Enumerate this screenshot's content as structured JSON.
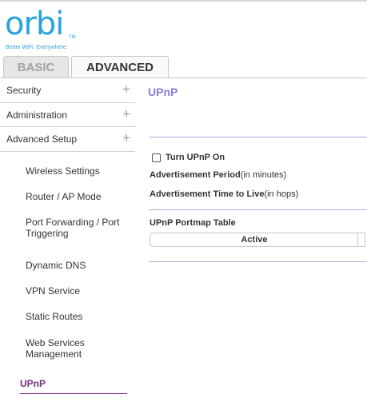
{
  "brand": {
    "logo_text": "orbi",
    "trademark": "TM",
    "tagline": "Better WiFi. Everywhere."
  },
  "tabs": [
    {
      "label": "BASIC",
      "active": false
    },
    {
      "label": "ADVANCED",
      "active": true
    }
  ],
  "sidebar": {
    "sections": [
      {
        "label": "Security",
        "expand_icon": "plus-icon"
      },
      {
        "label": "Administration",
        "expand_icon": "plus-icon"
      },
      {
        "label": "Advanced Setup",
        "expand_icon": "plus-icon"
      }
    ],
    "items": [
      {
        "label": "Wireless Settings"
      },
      {
        "label": "Router / AP Mode"
      },
      {
        "label": "Port Forwarding / Port Triggering"
      },
      {
        "label": "Dynamic DNS"
      },
      {
        "label": "VPN Service"
      },
      {
        "label": "Static Routes"
      },
      {
        "label": "Web Services Management"
      },
      {
        "label": "UPnP",
        "active": true
      }
    ]
  },
  "main": {
    "title": "UPnP",
    "turn_on": {
      "label": "Turn UPnP On",
      "checked": false
    },
    "advertisement_period": {
      "label": "Advertisement Period",
      "unit": "(in minutes)"
    },
    "advertisement_ttl": {
      "label": "Advertisement Time to Live",
      "unit": "(in hops)"
    },
    "portmap_table": {
      "title": "UPnP Portmap Table",
      "columns": [
        "Active"
      ]
    }
  },
  "colors": {
    "brand_blue": "#29a3dc",
    "accent_purple": "#8a7fd6",
    "active_nav": "#7b2c86"
  }
}
